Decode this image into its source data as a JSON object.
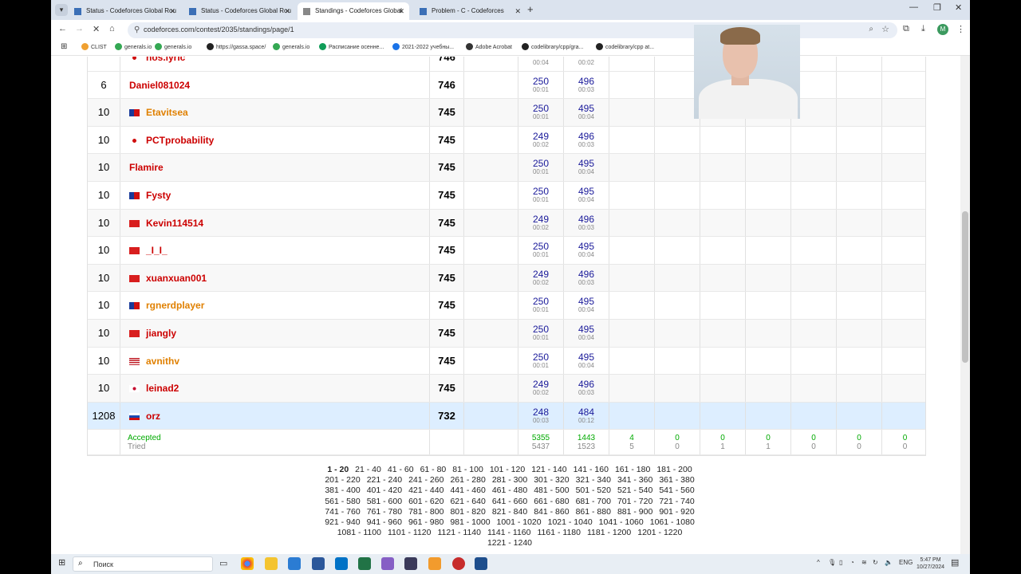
{
  "browser": {
    "tabs": [
      {
        "title": "Status - Codeforces Global Rou",
        "active": false
      },
      {
        "title": "Status - Codeforces Global Rou",
        "active": false
      },
      {
        "title": "Standings - Codeforces Global",
        "active": true
      },
      {
        "title": "Problem - C - Codeforces",
        "active": false
      }
    ],
    "new_tab": "+",
    "url": "codeforces.com/contest/2035/standings/page/1",
    "avatar_letter": "M",
    "bookmarks": [
      "CLIST",
      "generals.io",
      "generals.io",
      "https://gassa.space/",
      "generals.io",
      "Расписание осеннe...",
      "2021-2022 учебны...",
      "Adobe Acrobat",
      "codelibrary/cpp/gra...",
      "codelibrary/cpp at..."
    ]
  },
  "standings": {
    "partial_top": {
      "name": "nos.lyric",
      "score": "746",
      "times": [
        "00:04",
        "00:02"
      ]
    },
    "rows": [
      {
        "rank": "6",
        "name": "Daniel081024",
        "flag": "",
        "color": "red",
        "score": "746",
        "p1": "250",
        "t1": "00:01",
        "p2": "496",
        "t2": "00:03"
      },
      {
        "rank": "10",
        "name": "Etavitsea",
        "flag": "tw",
        "color": "orange",
        "score": "745",
        "p1": "250",
        "t1": "00:01",
        "p2": "495",
        "t2": "00:04"
      },
      {
        "rank": "10",
        "name": "PCTprobability",
        "flag": "jp",
        "color": "red",
        "score": "745",
        "p1": "249",
        "t1": "00:02",
        "p2": "496",
        "t2": "00:03"
      },
      {
        "rank": "10",
        "name": "Flamire",
        "flag": "",
        "color": "red",
        "score": "745",
        "p1": "250",
        "t1": "00:01",
        "p2": "495",
        "t2": "00:04"
      },
      {
        "rank": "10",
        "name": "Fysty",
        "flag": "tw",
        "color": "red",
        "score": "745",
        "p1": "250",
        "t1": "00:01",
        "p2": "495",
        "t2": "00:04"
      },
      {
        "rank": "10",
        "name": "Kevin114514",
        "flag": "cn",
        "color": "red",
        "score": "745",
        "p1": "249",
        "t1": "00:02",
        "p2": "496",
        "t2": "00:03"
      },
      {
        "rank": "10",
        "name": "_I_I_",
        "flag": "cn",
        "color": "red",
        "score": "745",
        "p1": "250",
        "t1": "00:01",
        "p2": "495",
        "t2": "00:04"
      },
      {
        "rank": "10",
        "name": "xuanxuan001",
        "flag": "cn",
        "color": "red",
        "score": "745",
        "p1": "249",
        "t1": "00:02",
        "p2": "496",
        "t2": "00:03"
      },
      {
        "rank": "10",
        "name": "rgnerdplayer",
        "flag": "tw",
        "color": "orange",
        "score": "745",
        "p1": "250",
        "t1": "00:01",
        "p2": "495",
        "t2": "00:04"
      },
      {
        "rank": "10",
        "name": "jiangly",
        "flag": "cn",
        "color": "red",
        "score": "745",
        "p1": "250",
        "t1": "00:01",
        "p2": "495",
        "t2": "00:04"
      },
      {
        "rank": "10",
        "name": "avnithv",
        "flag": "us",
        "color": "orange",
        "score": "745",
        "p1": "250",
        "t1": "00:01",
        "p2": "495",
        "t2": "00:04"
      },
      {
        "rank": "10",
        "name": "leinad2",
        "flag": "kr",
        "color": "red",
        "score": "745",
        "p1": "249",
        "t1": "00:02",
        "p2": "496",
        "t2": "00:03"
      },
      {
        "rank": "1208",
        "name": "orz",
        "flag": "ru",
        "color": "red",
        "score": "732",
        "p1": "248",
        "t1": "00:03",
        "p2": "484",
        "t2": "00:12",
        "highlight": true
      }
    ],
    "stats": {
      "accepted_label": "Accepted",
      "tried_label": "Tried",
      "accepted": [
        "5355",
        "1443",
        "4",
        "0",
        "0",
        "0",
        "0",
        "0",
        "0"
      ],
      "tried": [
        "5437",
        "1523",
        "5",
        "0",
        "1",
        "1",
        "0",
        "0",
        "0"
      ]
    }
  },
  "pagination": [
    "1 - 20",
    "21 - 40",
    "41 - 60",
    "61 - 80",
    "81 - 100",
    "101 - 120",
    "121 - 140",
    "141 - 160",
    "161 - 180",
    "181 - 200",
    "201 - 220",
    "221 - 240",
    "241 - 260",
    "261 - 280",
    "281 - 300",
    "301 - 320",
    "321 - 340",
    "341 - 360",
    "361 - 380",
    "381 - 400",
    "401 - 420",
    "421 - 440",
    "441 - 460",
    "461 - 480",
    "481 - 500",
    "501 - 520",
    "521 - 540",
    "541 - 560",
    "561 - 580",
    "581 - 600",
    "601 - 620",
    "621 - 640",
    "641 - 660",
    "661 - 680",
    "681 - 700",
    "701 - 720",
    "721 - 740",
    "741 - 760",
    "761 - 780",
    "781 - 800",
    "801 - 820",
    "821 - 840",
    "841 - 860",
    "861 - 880",
    "881 - 900",
    "901 - 920",
    "921 - 940",
    "941 - 960",
    "961 - 980",
    "981 - 1000",
    "1001 - 1020",
    "1021 - 1040",
    "1041 - 1060",
    "1061 - 1080",
    "1081 - 1100",
    "1101 - 1120",
    "1121 - 1140",
    "1141 - 1160",
    "1161 - 1180",
    "1181 - 1200",
    "1201 - 1220",
    "1221 - 1240"
  ],
  "taskbar": {
    "search_placeholder": "Поиск",
    "language": "ENG",
    "time": "5:47 PM",
    "date": "10/27/2024"
  }
}
